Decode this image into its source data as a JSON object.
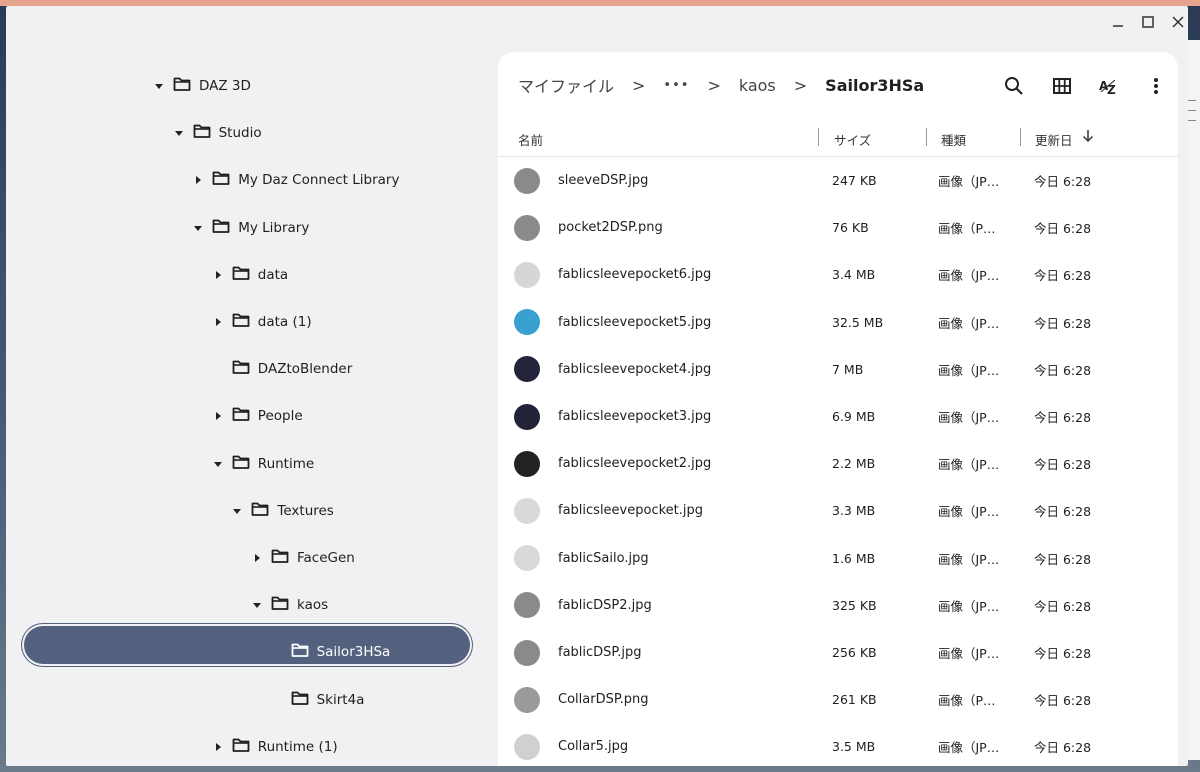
{
  "colors": {
    "window_bg": "#f1f1f4",
    "main_bg": "#ffffff",
    "selected_pill": "#53617f",
    "selected_text": "#ffffff"
  },
  "window_controls": {
    "minimize": "minimize-icon",
    "maximize": "maximize-icon",
    "close": "close-icon"
  },
  "tree": [
    {
      "label": "DAZ 3D",
      "depth": 0,
      "expanded": true
    },
    {
      "label": "Studio",
      "depth": 1,
      "expanded": true
    },
    {
      "label": "My Daz Connect Library",
      "depth": 2,
      "expanded": false
    },
    {
      "label": "My Library",
      "depth": 2,
      "expanded": true
    },
    {
      "label": "data",
      "depth": 3,
      "expanded": false
    },
    {
      "label": "data (1)",
      "depth": 3,
      "expanded": false
    },
    {
      "label": "DAZtoBlender",
      "depth": 3,
      "expanded": null
    },
    {
      "label": "People",
      "depth": 3,
      "expanded": false
    },
    {
      "label": "Runtime",
      "depth": 3,
      "expanded": true
    },
    {
      "label": "Textures",
      "depth": 4,
      "expanded": true
    },
    {
      "label": "FaceGen",
      "depth": 5,
      "expanded": false
    },
    {
      "label": "kaos",
      "depth": 5,
      "expanded": true
    },
    {
      "label": "Sailor3HSa",
      "depth": 6,
      "expanded": null,
      "selected": true
    },
    {
      "label": "Skirt4a",
      "depth": 6,
      "expanded": null
    },
    {
      "label": "Runtime (1)",
      "depth": 3,
      "expanded": false
    }
  ],
  "breadcrumb": {
    "root": "マイファイル",
    "ellipsis": "•••",
    "parent": "kaos",
    "current": "Sailor3HSa",
    "separator": ">"
  },
  "toolbar": {
    "search": "search-icon",
    "grid": "grid-view-icon",
    "sort": "sort-az-icon",
    "more": "more-vert-icon"
  },
  "columns": {
    "name": "名前",
    "size": "サイズ",
    "type": "種類",
    "date": "更新日"
  },
  "files": [
    {
      "name": "sleeveDSP.jpg",
      "size": "247 KB",
      "type": "画像（JP…",
      "date": "今日 6:28",
      "thumb": "#8a8a8a"
    },
    {
      "name": "pocket2DSP.png",
      "size": "76 KB",
      "type": "画像（P…",
      "date": "今日 6:28",
      "thumb": "#8a8a8a"
    },
    {
      "name": "fablicsleevepocket6.jpg",
      "size": "3.4 MB",
      "type": "画像（JP…",
      "date": "今日 6:28",
      "thumb": "#d6d6d6"
    },
    {
      "name": "fablicsleevepocket5.jpg",
      "size": "32.5 MB",
      "type": "画像（JP…",
      "date": "今日 6:28",
      "thumb": "#3aa0d0"
    },
    {
      "name": "fablicsleevepocket4.jpg",
      "size": "7 MB",
      "type": "画像（JP…",
      "date": "今日 6:28",
      "thumb": "#23233a"
    },
    {
      "name": "fablicsleevepocket3.jpg",
      "size": "6.9 MB",
      "type": "画像（JP…",
      "date": "今日 6:28",
      "thumb": "#232338"
    },
    {
      "name": "fablicsleevepocket2.jpg",
      "size": "2.2 MB",
      "type": "画像（JP…",
      "date": "今日 6:28",
      "thumb": "#222222"
    },
    {
      "name": "fablicsleevepocket.jpg",
      "size": "3.3 MB",
      "type": "画像（JP…",
      "date": "今日 6:28",
      "thumb": "#d9d9d9"
    },
    {
      "name": "fablicSailo.jpg",
      "size": "1.6 MB",
      "type": "画像（JP…",
      "date": "今日 6:28",
      "thumb": "#d9d9d9"
    },
    {
      "name": "fablicDSP2.jpg",
      "size": "325 KB",
      "type": "画像（JP…",
      "date": "今日 6:28",
      "thumb": "#8a8a8a"
    },
    {
      "name": "fablicDSP.jpg",
      "size": "256 KB",
      "type": "画像（JP…",
      "date": "今日 6:28",
      "thumb": "#8a8a8a"
    },
    {
      "name": "CollarDSP.png",
      "size": "261 KB",
      "type": "画像（P…",
      "date": "今日 6:28",
      "thumb": "#9a9a9a"
    },
    {
      "name": "Collar5.jpg",
      "size": "3.5 MB",
      "type": "画像（JP…",
      "date": "今日 6:28",
      "thumb": "#d0d0d0"
    }
  ]
}
